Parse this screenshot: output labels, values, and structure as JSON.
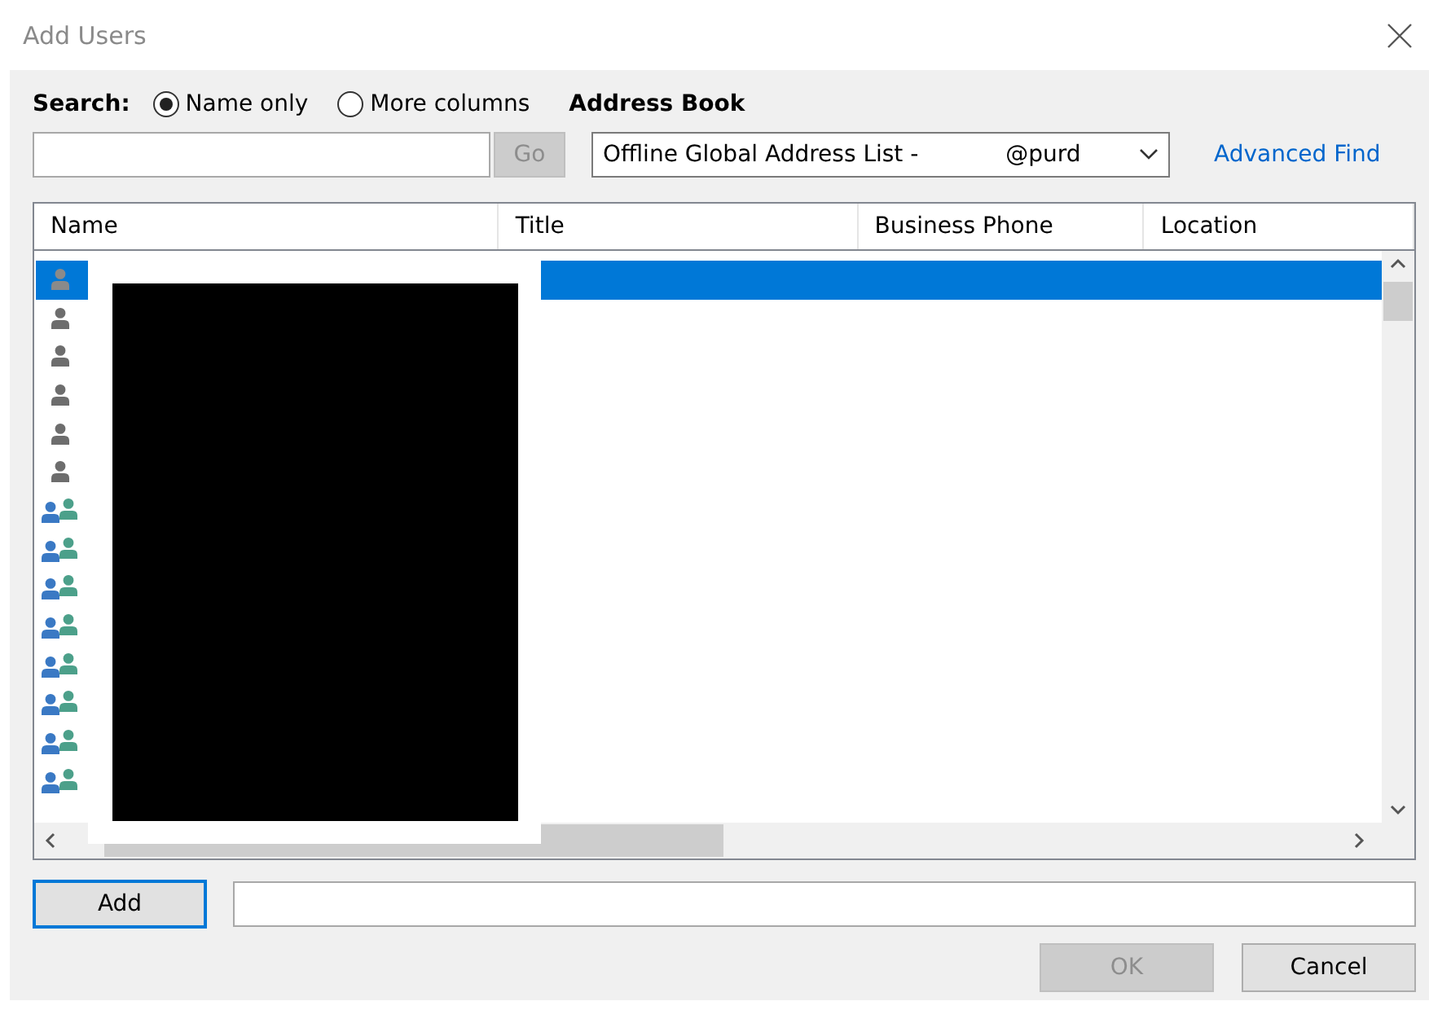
{
  "window": {
    "title": "Add Users"
  },
  "search": {
    "label": "Search:",
    "options": [
      {
        "label": "Name only",
        "selected": true
      },
      {
        "label": "More columns",
        "selected": false
      }
    ],
    "go": "Go"
  },
  "address_book": {
    "label": "Address Book",
    "value": "Offline Global Address List -            @purd",
    "advanced_find": "Advanced Find"
  },
  "table": {
    "columns": [
      "Name",
      "Title",
      "Business Phone",
      "Location"
    ],
    "rows": [
      {
        "kind": "user",
        "selected": true
      },
      {
        "kind": "user",
        "selected": false
      },
      {
        "kind": "user",
        "selected": false
      },
      {
        "kind": "user",
        "selected": false
      },
      {
        "kind": "user",
        "selected": false
      },
      {
        "kind": "user",
        "selected": false
      },
      {
        "kind": "group",
        "selected": false
      },
      {
        "kind": "group",
        "selected": false
      },
      {
        "kind": "group",
        "selected": false
      },
      {
        "kind": "group",
        "selected": false
      },
      {
        "kind": "group",
        "selected": false
      },
      {
        "kind": "group",
        "selected": false
      },
      {
        "kind": "group",
        "selected": false
      },
      {
        "kind": "group",
        "selected": false
      }
    ]
  },
  "add": {
    "button": "Add"
  },
  "buttons": [
    {
      "label": "OK",
      "disabled": true
    },
    {
      "label": "Cancel",
      "disabled": false
    }
  ]
}
